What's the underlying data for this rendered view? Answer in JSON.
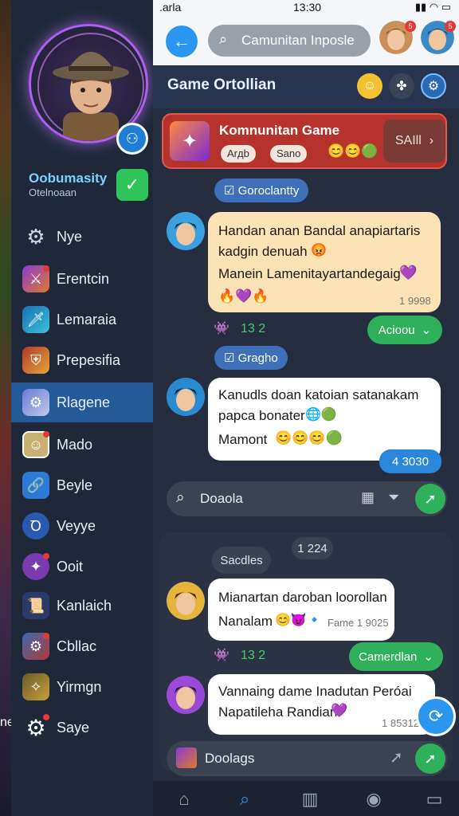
{
  "background": {
    "edge_text": "ne"
  },
  "status_bar": {
    "carrier": ".arla",
    "time": "13:30",
    "right": "▮▮ ◠ ▭"
  },
  "top_bar": {
    "search_placeholder": "Camunitan Inposle",
    "avatar_badges": [
      "5",
      "5"
    ]
  },
  "sidebar": {
    "profile_name": "Oobumasity",
    "profile_sub": "Otelnoaan",
    "items": [
      {
        "label": "Nye",
        "icon": "gear-icon",
        "active": false
      },
      {
        "label": "Erentcin",
        "icon": "warrior-icon",
        "active": false
      },
      {
        "label": "Lemaraia",
        "icon": "sword-icon",
        "active": false
      },
      {
        "label": "Prepesifia",
        "icon": "shield-icon",
        "active": false
      },
      {
        "label": "Rlagene",
        "icon": "robot-icon",
        "active": true
      },
      {
        "label": "Mado",
        "icon": "person-icon",
        "active": false
      },
      {
        "label": "Beyle",
        "icon": "link-icon",
        "active": false
      },
      {
        "label": "Veyye",
        "icon": "badge-icon",
        "active": false
      },
      {
        "label": "Ooit",
        "icon": "wand-icon",
        "active": false
      },
      {
        "label": "Kanlaich",
        "icon": "scroll-icon",
        "active": false
      },
      {
        "label": "Cbllac",
        "icon": "mech-icon",
        "active": false
      },
      {
        "label": "Yirmgn",
        "icon": "treasure-icon",
        "active": false
      },
      {
        "label": "Saye",
        "icon": "gear-icon",
        "active": false
      }
    ]
  },
  "section": {
    "title": "Game Ortollian"
  },
  "game_card": {
    "title": "Komnunitan Game",
    "tags": [
      "Arдb",
      "Sano"
    ],
    "button_label": "SAIll"
  },
  "chat": {
    "label_1": "Goroclantty",
    "message_1": {
      "line_1": "Handan anan Bandal anapiartaris",
      "line_2": "kadgin denuah",
      "line_3": "Manein Lamenitayartandegaig",
      "time": "1 9998"
    },
    "count_1": "13 2",
    "action_1": "Acioou",
    "label_2": "Gragho",
    "message_2": {
      "line_1": "Kanudls doan katoian satanakam",
      "line_2": "papca bonater",
      "line_3": "Mamont",
      "time": "4 3030"
    },
    "input_text": "Doaola",
    "lower_pill": "Sacdles",
    "lower_time": "1 224",
    "message_3": {
      "line_1": "Mianartan daroban loorollan",
      "line_2": "Nanalam",
      "meta": "Fame 1 9025"
    },
    "count_2": "13 2",
    "action_2": "Camerdlan",
    "message_4": {
      "line_1": "Vannaing dame Inadutan Peróai",
      "line_2": "Napatileha Randian",
      "time": "1 85312"
    },
    "bottom_input_text": "Doolags"
  },
  "colors": {
    "accent": "#2a96ef",
    "green": "#2fb05a",
    "card": "#b5332c",
    "sidebar_active": "#245a9a"
  }
}
